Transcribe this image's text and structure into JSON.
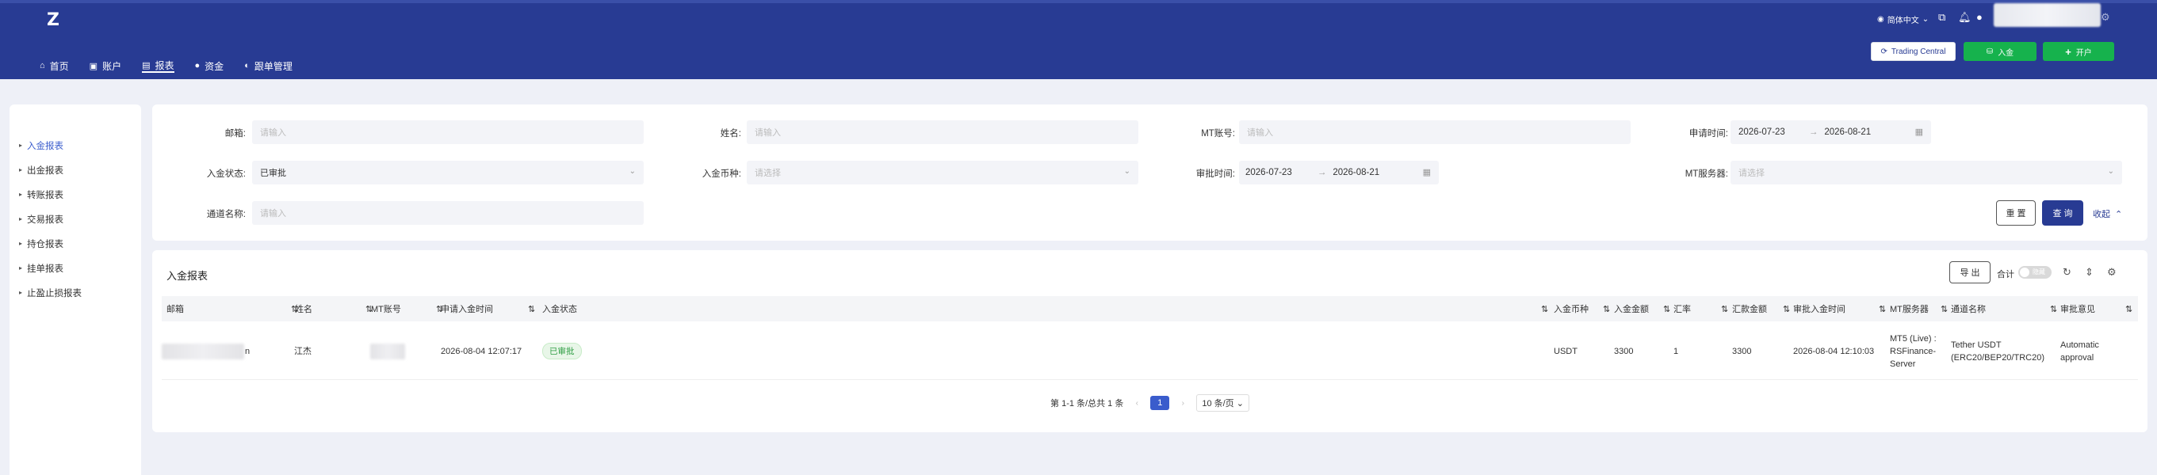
{
  "header": {
    "logo_text": "Z",
    "nav": [
      {
        "label": "首页",
        "icon": "home-icon"
      },
      {
        "label": "账户",
        "icon": "account-icon"
      },
      {
        "label": "报表",
        "icon": "report-icon"
      },
      {
        "label": "资金",
        "icon": "funds-icon"
      },
      {
        "label": "跟单管理",
        "icon": "copy-trade-icon"
      }
    ],
    "language": "简体中文",
    "trading_central_label": "Trading Central",
    "deposit_label": "入金",
    "open_account_label": "开户"
  },
  "sidebar": {
    "items": [
      {
        "label": "入金报表",
        "active": true
      },
      {
        "label": "出金报表",
        "active": false
      },
      {
        "label": "转账报表",
        "active": false
      },
      {
        "label": "交易报表",
        "active": false
      },
      {
        "label": "持仓报表",
        "active": false
      },
      {
        "label": "挂单报表",
        "active": false
      },
      {
        "label": "止盈止损报表",
        "active": false
      }
    ]
  },
  "filters": {
    "email_label": "邮箱:",
    "email_placeholder": "请输入",
    "name_label": "姓名:",
    "name_placeholder": "请输入",
    "mt_label": "MT账号:",
    "mt_placeholder": "请输入",
    "apply_time_label": "申请时间:",
    "apply_start": "2026-07-23",
    "apply_end": "2026-08-21",
    "status_label": "入金状态:",
    "status_value": "已审批",
    "currency_label": "入金币种:",
    "currency_placeholder": "请选择",
    "approve_time_label": "审批时间:",
    "approve_start": "2026-07-23",
    "approve_end": "2026-08-21",
    "server_label": "MT服务器:",
    "server_placeholder": "请选择",
    "channel_label": "通道名称:",
    "channel_placeholder": "请输入",
    "range_sep": "→",
    "reset_label": "重 置",
    "query_label": "查 询",
    "collapse_label": "收起"
  },
  "report": {
    "title": "入金报表",
    "export_label": "导 出",
    "sum_label": "合计",
    "toggle_text": "隐藏",
    "columns": [
      "邮箱",
      "姓名",
      "MT账号",
      "申请入金时间",
      "入金状态",
      "入金币种",
      "入金金额",
      "汇率",
      "汇款金额",
      "审批入金时间",
      "MT服务器",
      "通道名称",
      "审批意见"
    ],
    "row": {
      "email_suffix": "n",
      "name": "江杰",
      "apply_time": "2026-08-04 12:07:17",
      "status": "已审批",
      "currency": "USDT",
      "amount": "3300",
      "rate": "1",
      "remit": "3300",
      "approve_time": "2026-08-04 12:10:03",
      "server_l1": "MT5 (Live) :",
      "server_l2": "RSFinance-",
      "server_l3": "Server",
      "channel_l1": "Tether USDT",
      "channel_l2": "(ERC20/BEP20/TRC20)",
      "opinion_l1": "Automatic",
      "opinion_l2": "approval"
    },
    "pager": {
      "summary": "第 1-1 条/总共 1 条",
      "current": "1",
      "page_size": "10 条/页"
    }
  }
}
